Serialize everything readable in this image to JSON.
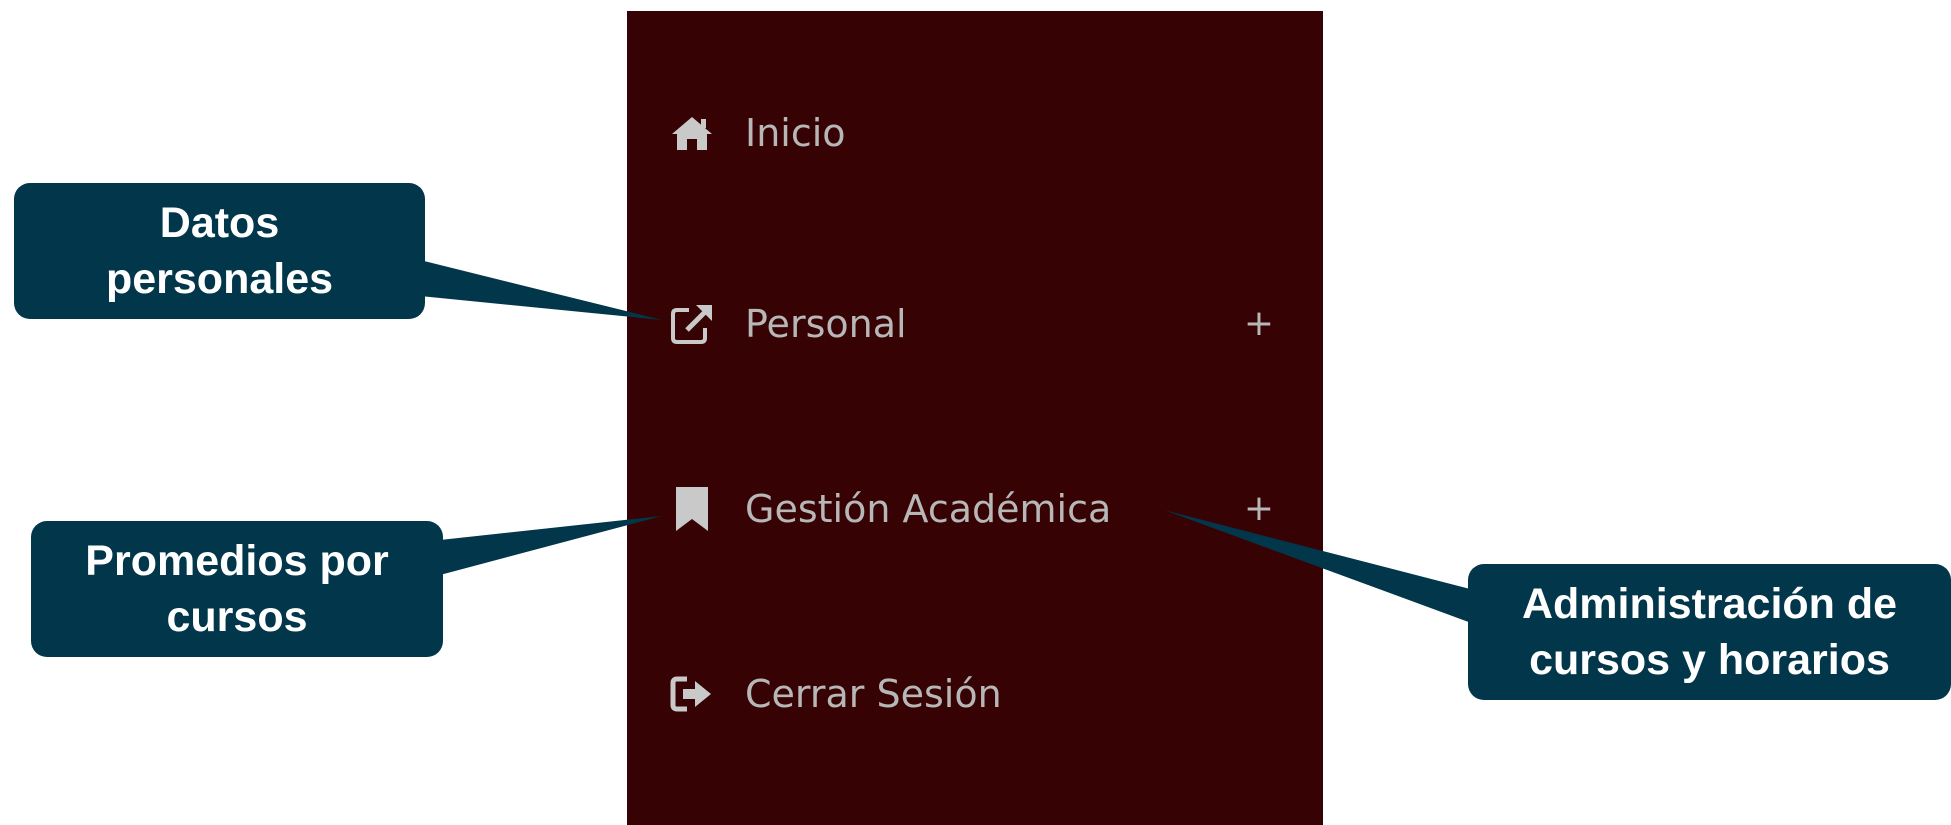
{
  "sidebar": {
    "background": "#360203",
    "text_color": "#b7b7b7",
    "items": [
      {
        "label": "Inicio",
        "icon": "home-icon",
        "expand": ""
      },
      {
        "label": "Personal",
        "icon": "external-link-icon",
        "expand": "+"
      },
      {
        "label": "Gestión Académica",
        "icon": "bookmark-icon",
        "expand": "+"
      },
      {
        "label": "Cerrar Sesión",
        "icon": "sign-out-icon",
        "expand": ""
      }
    ]
  },
  "annotations": {
    "color": "#02364b",
    "datos_personales": {
      "line1": "Datos",
      "line2": "personales"
    },
    "promedios": {
      "line1": "Promedios por",
      "line2": "cursos"
    },
    "administracion": {
      "line1": "Administración de",
      "line2": "cursos y horarios"
    }
  }
}
